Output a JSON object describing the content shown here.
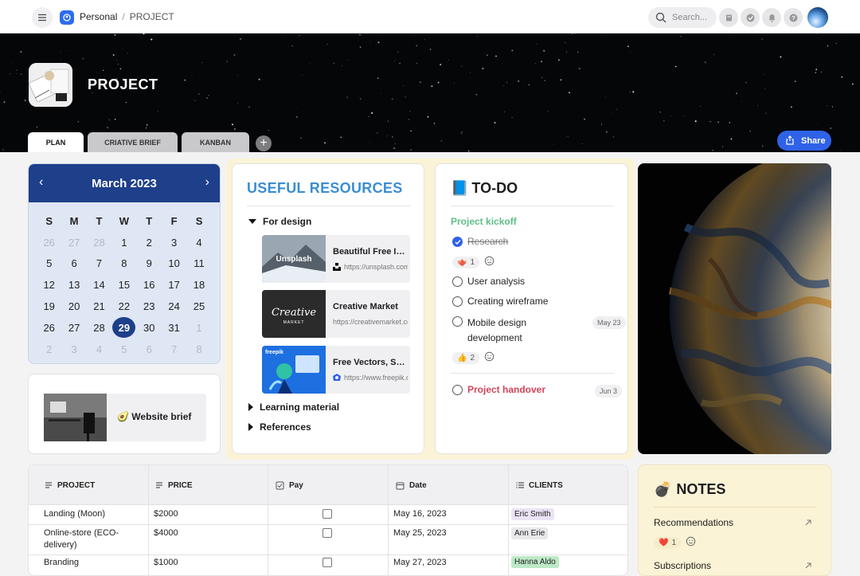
{
  "topbar": {
    "workspace": "Personal",
    "separator": "/",
    "current": "PROJECT",
    "search_placeholder": "Search..."
  },
  "banner": {
    "title": "PROJECT",
    "tabs": [
      {
        "label": "PLAN",
        "active": true
      },
      {
        "label": "CRIATIVE BRIEF",
        "active": false
      },
      {
        "label": "KANBAN",
        "active": false
      }
    ],
    "add_tab": "+",
    "share_label": "Share"
  },
  "calendar": {
    "month": "March 2023",
    "prev": "‹",
    "next": "›",
    "weekdays": [
      "S",
      "M",
      "T",
      "W",
      "T",
      "F",
      "S"
    ],
    "days": [
      [
        "26",
        "27",
        "28",
        "1",
        "2",
        "3",
        "4"
      ],
      [
        "5",
        "6",
        "7",
        "8",
        "9",
        "10",
        "11"
      ],
      [
        "12",
        "13",
        "14",
        "15",
        "16",
        "17",
        "18"
      ],
      [
        "19",
        "20",
        "21",
        "22",
        "23",
        "24",
        "25"
      ],
      [
        "26",
        "27",
        "28",
        "29",
        "30",
        "31",
        "1"
      ],
      [
        "2",
        "3",
        "4",
        "5",
        "6",
        "7",
        "8"
      ]
    ],
    "selected": "29"
  },
  "brief": {
    "emoji": "🥑",
    "label": "Website brief"
  },
  "resources": {
    "title": "USEFUL RESOURCES",
    "sections": [
      {
        "label": "For design",
        "expanded": true
      },
      {
        "label": "Learning material",
        "expanded": false
      },
      {
        "label": "References",
        "expanded": false
      }
    ],
    "links": [
      {
        "title": "Beautiful Free Images",
        "url": "https://unsplash.com",
        "thumb_text": "Unsplash"
      },
      {
        "title": "Creative Market",
        "url": "https://creativemarket.com",
        "thumb_text": "Creative",
        "thumb_sub": "MARKET"
      },
      {
        "title": "Free Vectors, Stock Photos",
        "url": "https://www.freepik.com",
        "thumb_text": "freepik"
      }
    ]
  },
  "todo": {
    "emoji": "📘",
    "title": "TO-DO",
    "group": "Project kickoff",
    "items": [
      {
        "label": "Research",
        "done": true
      },
      {
        "label": "User analysis",
        "done": false
      },
      {
        "label": "Creating wireframe",
        "done": false
      },
      {
        "label": "Mobile design development",
        "done": false,
        "date": "May 23"
      },
      {
        "label": "Project handover",
        "done": false,
        "date": "Jun 3"
      }
    ],
    "reactions": [
      {
        "emoji": "🫖",
        "count": "1"
      },
      {
        "emoji": "👍",
        "count": "2"
      }
    ]
  },
  "table": {
    "headers": [
      "PROJECT",
      "PRICE",
      "Pay",
      "Date",
      "CLIENTS"
    ],
    "rows": [
      {
        "project": "Landing (Moon)",
        "price": "$2000",
        "date": "May 16, 2023",
        "client": "Eric Smith",
        "client_color": "#ebe3f5"
      },
      {
        "project": "Online-store (ECO-delivery)",
        "price": "$4000",
        "date": "May 25, 2023",
        "client": "Ann Erie",
        "client_color": "#e8e8ea"
      },
      {
        "project": "Branding",
        "price": "$1000",
        "date": "May 27, 2023",
        "client": "Hanna Aldo",
        "client_color": "#bde9c7"
      }
    ]
  },
  "notes": {
    "emoji": "💣",
    "title": "NOTES",
    "items": [
      {
        "label": "Recommendations",
        "reaction": "❤️",
        "count": "1"
      },
      {
        "label": "Subscriptions"
      }
    ]
  },
  "colors": {
    "accent": "#2f62e8",
    "calendar_header": "#1e3f8a",
    "resources_title": "#3a8ed3",
    "kickoff": "#5ec087",
    "handover": "#d2445a",
    "note_bg": "#fbf3d6"
  }
}
